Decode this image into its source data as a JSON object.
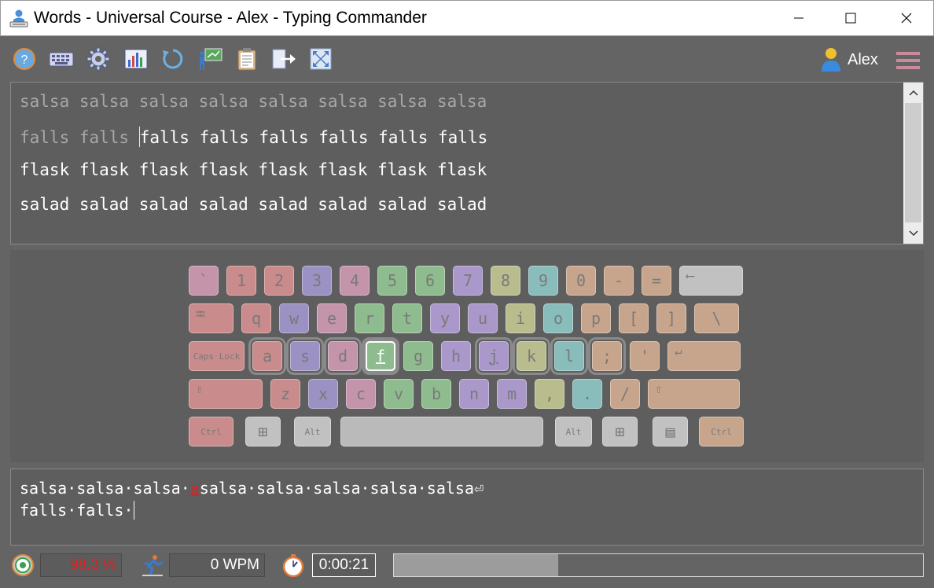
{
  "window": {
    "title": "Words - Universal Course - Alex - Typing Commander",
    "minimize_icon": "minimize-icon",
    "maximize_icon": "maximize-icon",
    "close_icon": "close-icon"
  },
  "toolbar": {
    "buttons": [
      "help-icon",
      "keyboard-icon",
      "settings-gear-icon",
      "statistics-icon",
      "restart-icon",
      "teacher-icon",
      "lessons-clipboard-icon",
      "exit-icon",
      "fullscreen-icon"
    ],
    "user_name": "Alex",
    "user_icon": "user-icon",
    "menu_icon": "hamburger-menu-icon"
  },
  "lesson": {
    "lines": [
      {
        "done": "salsa salsa salsa salsa salsa salsa salsa salsa",
        "pending": ""
      },
      {
        "done": "falls falls ",
        "pending": "falls falls falls falls falls falls"
      },
      {
        "done": "",
        "pending": "flask flask flask flask flask flask flask flask"
      },
      {
        "done": "",
        "pending": "salad salad salad salad salad salad salad salad"
      }
    ]
  },
  "keyboard": {
    "colors": {
      "red": "#c98b8b",
      "purple": "#9b91c2",
      "pink": "#c494ab",
      "green": "#8fbc8f",
      "lavender": "#a998c9",
      "lime": "#b9bd8e",
      "teal": "#88bdbb",
      "orange": "#c7a58c",
      "gray": "#c1c1c1",
      "space": "#bababa"
    },
    "rows": [
      [
        {
          "label": "`",
          "c": "pink"
        },
        {
          "label": "1",
          "c": "red"
        },
        {
          "label": "2",
          "c": "red"
        },
        {
          "label": "3",
          "c": "purple"
        },
        {
          "label": "4",
          "c": "pink"
        },
        {
          "label": "5",
          "c": "green"
        },
        {
          "label": "6",
          "c": "green"
        },
        {
          "label": "7",
          "c": "lavender"
        },
        {
          "label": "8",
          "c": "lime"
        },
        {
          "label": "9",
          "c": "teal"
        },
        {
          "label": "0",
          "c": "orange"
        },
        {
          "label": "-",
          "c": "orange"
        },
        {
          "label": "=",
          "c": "orange"
        },
        {
          "label": "⟵",
          "c": "gray",
          "w": "backspace"
        }
      ],
      [
        {
          "label": "⭾",
          "c": "red",
          "w": "tab"
        },
        {
          "label": "q",
          "c": "red"
        },
        {
          "label": "w",
          "c": "purple"
        },
        {
          "label": "e",
          "c": "pink"
        },
        {
          "label": "r",
          "c": "green"
        },
        {
          "label": "t",
          "c": "green"
        },
        {
          "label": "y",
          "c": "lavender"
        },
        {
          "label": "u",
          "c": "lavender"
        },
        {
          "label": "i",
          "c": "lime"
        },
        {
          "label": "o",
          "c": "teal"
        },
        {
          "label": "p",
          "c": "orange"
        },
        {
          "label": "[",
          "c": "orange"
        },
        {
          "label": "]",
          "c": "orange"
        },
        {
          "label": "\\",
          "c": "orange",
          "w": "backslash"
        }
      ],
      [
        {
          "label": "Caps Lock",
          "c": "red",
          "w": "caps"
        },
        {
          "label": "a",
          "c": "red"
        },
        {
          "label": "s",
          "c": "purple"
        },
        {
          "label": "d",
          "c": "pink"
        },
        {
          "label": "f",
          "c": "green"
        },
        {
          "label": "g",
          "c": "green"
        },
        {
          "label": "h",
          "c": "lavender"
        },
        {
          "label": "j",
          "c": "lavender"
        },
        {
          "label": "k",
          "c": "lime"
        },
        {
          "label": "l",
          "c": "teal"
        },
        {
          "label": ";",
          "c": "orange"
        },
        {
          "label": "'",
          "c": "orange"
        },
        {
          "label": "↵",
          "c": "orange",
          "w": "enter"
        }
      ],
      [
        {
          "label": "⇧",
          "c": "red",
          "w": "lshift"
        },
        {
          "label": "z",
          "c": "red"
        },
        {
          "label": "x",
          "c": "purple"
        },
        {
          "label": "c",
          "c": "pink"
        },
        {
          "label": "v",
          "c": "green"
        },
        {
          "label": "b",
          "c": "green"
        },
        {
          "label": "n",
          "c": "lavender"
        },
        {
          "label": "m",
          "c": "lavender"
        },
        {
          "label": ",",
          "c": "lime"
        },
        {
          "label": ".",
          "c": "teal"
        },
        {
          "label": "/",
          "c": "orange"
        },
        {
          "label": "⇧",
          "c": "orange",
          "w": "rshift"
        }
      ],
      [
        {
          "label": "Ctrl",
          "c": "red",
          "w": "ctrl"
        },
        {
          "label": "⊞",
          "c": "gray",
          "w": "win"
        },
        {
          "label": "Alt",
          "c": "gray",
          "w": "alt"
        },
        {
          "label": "",
          "c": "space",
          "w": "space"
        },
        {
          "label": "Alt",
          "c": "gray",
          "w": "alt"
        },
        {
          "label": "⊞",
          "c": "gray",
          "w": "win"
        },
        {
          "label": "▤",
          "c": "gray",
          "w": "win"
        },
        {
          "label": "Ctrl",
          "c": "orange",
          "w": "ctrl"
        }
      ]
    ],
    "active_key": "f",
    "home_keys": [
      "a",
      "s",
      "d",
      "f",
      "j",
      "k",
      "l",
      ";"
    ]
  },
  "input": {
    "line1_before": "salsa·salsa·salsa·",
    "line1_error": "a",
    "line1_after": "salsa·salsa·salsa·salsa·salsa⏎",
    "line2": "falls·falls·"
  },
  "status": {
    "accuracy_icon": "target-icon",
    "accuracy": "98.3 %",
    "speed_icon": "runner-icon",
    "speed": "0 WPM",
    "timer_icon": "stopwatch-icon",
    "time": "0:00:21",
    "progress": 0.31
  }
}
